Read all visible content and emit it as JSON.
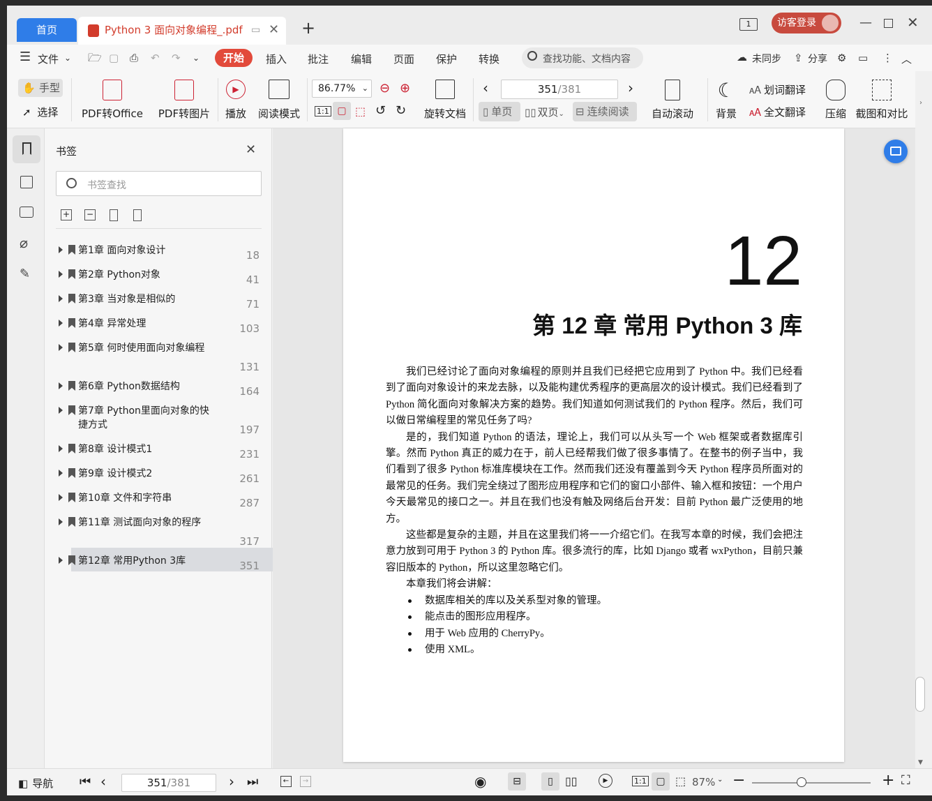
{
  "tabs": {
    "home": "首页",
    "doc": "Python 3 面向对象编程_.pdf",
    "guest": "访客登录"
  },
  "menu": {
    "file": "文件",
    "items": [
      "开始",
      "插入",
      "批注",
      "编辑",
      "页面",
      "保护",
      "转换"
    ],
    "search": "查找功能、文档内容",
    "sync": "未同步",
    "share": "分享"
  },
  "ribbon": {
    "hand": "手型",
    "select": "选择",
    "pdf_office": "PDF转Office",
    "pdf_image": "PDF转图片",
    "play": "播放",
    "reading": "阅读模式",
    "zoom": "86.77%",
    "rotate": "旋转文档",
    "page_current": "351",
    "page_total": "/381",
    "single": "单页",
    "double": "双页",
    "continuous": "连续阅读",
    "autoscroll": "自动滚动",
    "background": "背景",
    "word_translate": "划词翻译",
    "full_translate": "全文翻译",
    "compress": "压缩",
    "screenshot": "截图和对比"
  },
  "panel": {
    "title": "书签",
    "search_placeholder": "书签查找"
  },
  "bookmarks": [
    {
      "label": "第1章  面向对象设计",
      "page": "18"
    },
    {
      "label": "第2章  Python对象",
      "page": "41"
    },
    {
      "label": "第3章  当对象是相似的",
      "page": "71"
    },
    {
      "label": "第4章  异常处理",
      "page": "103"
    },
    {
      "label": "第5章  何时使用面向对象编程",
      "page": "131"
    },
    {
      "label": "第6章  Python数据结构",
      "page": "164"
    },
    {
      "label": "第7章  Python里面向对象的快捷方式",
      "page": "197"
    },
    {
      "label": "第8章  设计模式1",
      "page": "231"
    },
    {
      "label": "第9章  设计模式2",
      "page": "261"
    },
    {
      "label": "第10章  文件和字符串",
      "page": "287"
    },
    {
      "label": "第11章  测试面向对象的程序",
      "page": "317"
    },
    {
      "label": "第12章  常用Python 3库",
      "page": "351"
    }
  ],
  "content": {
    "chapter_number": "12",
    "chapter_title": "第 12 章    常用 Python 3 库",
    "paragraphs": [
      "我们已经讨论了面向对象编程的原则并且我们已经把它应用到了 Python 中。我们已经看到了面向对象设计的来龙去脉，以及能构建优秀程序的更高层次的设计模式。我们已经看到了 Python 简化面向对象解决方案的趋势。我们知道如何测试我们的 Python 程序。然后，我们可以做日常编程里的常见任务了吗?",
      "是的，我们知道 Python 的语法，理论上，我们可以从头写一个 Web 框架或者数据库引擎。然而 Python 真正的威力在于，前人已经帮我们做了很多事情了。在整书的例子当中，我们看到了很多 Python 标准库模块在工作。然而我们还没有覆盖到今天 Python 程序员所面对的最常见的任务。我们完全绕过了图形应用程序和它们的窗口小部件、输入框和按钮：一个用户今天最常见的接口之一。并且在我们也没有触及网络后台开发：目前 Python 最广泛使用的地方。",
      "这些都是复杂的主题，并且在这里我们将一一介绍它们。在我写本章的时候，我们会把注意力放到可用于 Python 3 的 Python 库。很多流行的库，比如 Django 或者 wxPython，目前只兼容旧版本的 Python，所以这里忽略它们。",
      "本章我们将会讲解："
    ],
    "bullets": [
      "数据库相关的库以及关系型对象的管理。",
      "能点击的图形应用程序。",
      "用于 Web 应用的 CherryPy。",
      "使用 XML。"
    ]
  },
  "status": {
    "nav": "导航",
    "page_current": "351",
    "page_total": "/381",
    "zoom": "87%"
  }
}
